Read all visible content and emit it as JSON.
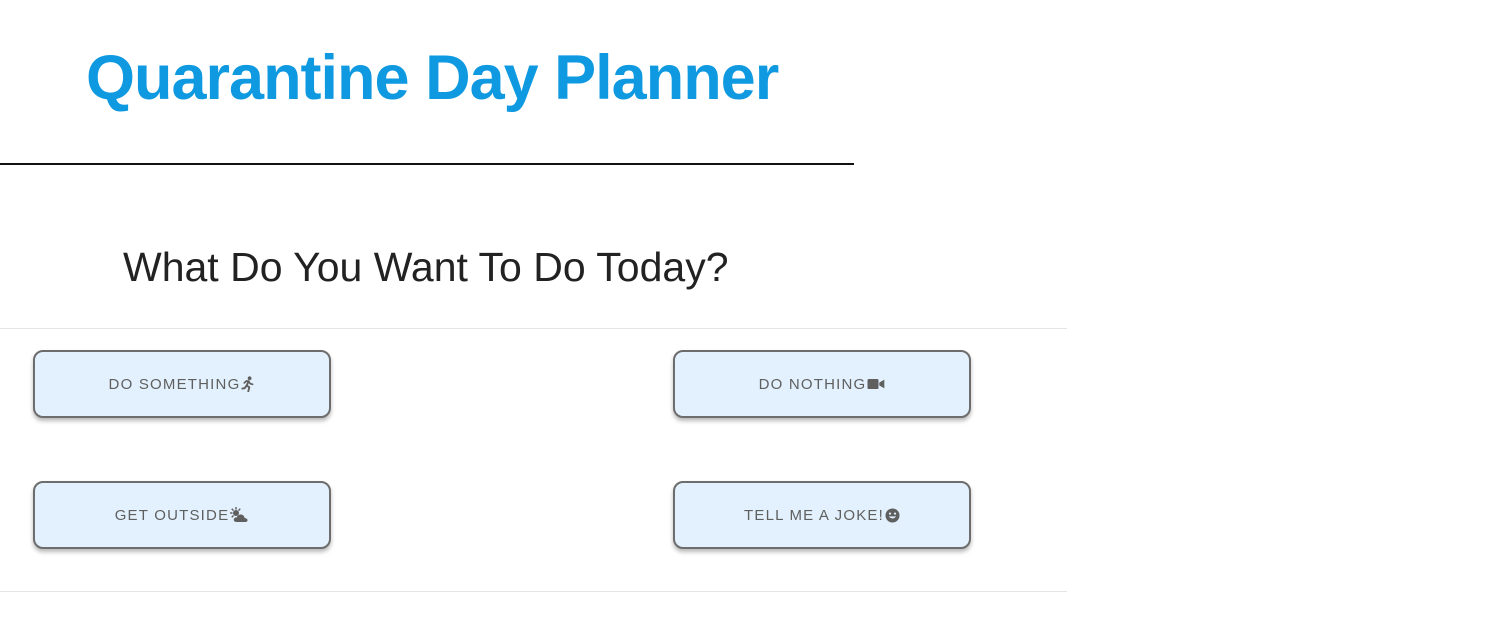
{
  "header": {
    "title": "Quarantine Day Planner",
    "title_color": "#0e99e0"
  },
  "main": {
    "question": "What Do You Want To Do Today?",
    "buttons": [
      {
        "label": "Do Something",
        "icon": "running-person-icon"
      },
      {
        "label": "Do Nothing",
        "icon": "video-camera-icon"
      },
      {
        "label": "Get Outside",
        "icon": "sun-behind-cloud-icon"
      },
      {
        "label": "Tell Me A Joke!",
        "icon": "smiley-face-icon"
      }
    ]
  },
  "colors": {
    "button_background": "#e2f1fd",
    "button_border": "#6d6d6d",
    "button_text": "#5f5f5f"
  }
}
